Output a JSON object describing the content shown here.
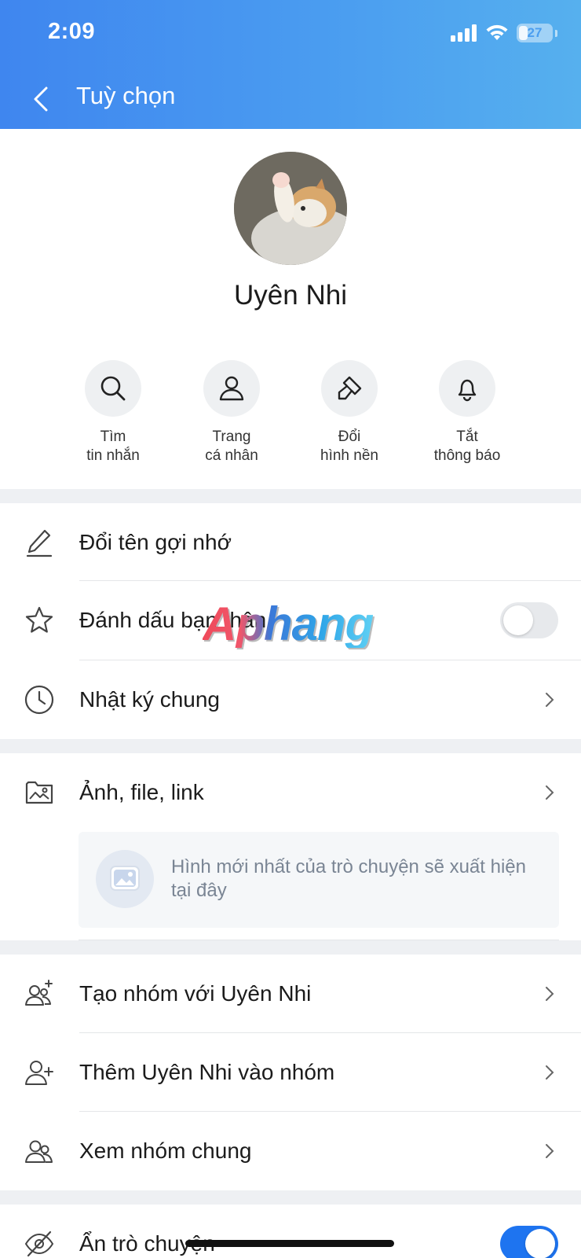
{
  "status_bar": {
    "time": "2:09",
    "battery": "27"
  },
  "header": {
    "title": "Tuỳ chọn"
  },
  "profile": {
    "name": "Uyên Nhi"
  },
  "quick_actions": [
    {
      "line1": "Tìm",
      "line2": "tin nhắn",
      "icon": "search-icon"
    },
    {
      "line1": "Trang",
      "line2": "cá nhân",
      "icon": "user-icon"
    },
    {
      "line1": "Đổi",
      "line2": "hình nền",
      "icon": "brush-icon"
    },
    {
      "line1": "Tắt",
      "line2": "thông báo",
      "icon": "bell-icon"
    }
  ],
  "settings": {
    "rename": "Đổi tên gợi nhớ",
    "close_friend": {
      "label": "Đánh dấu bạn thân",
      "on": false
    },
    "shared_diary": "Nhật ký chung",
    "media": {
      "label": "Ảnh, file, link",
      "empty_text": "Hình mới nhất của trò chuyện sẽ xuất hiện tại đây"
    },
    "create_group": "Tạo nhóm với Uyên Nhi",
    "add_to_group": "Thêm Uyên Nhi vào nhóm",
    "common_groups": "Xem nhóm chung",
    "hide_chat": {
      "label": "Ẩn trò chuyện",
      "on": true
    }
  },
  "watermark": "Aphang",
  "colors": {
    "header_start": "#3f86ef",
    "header_end": "#56b0ee",
    "toggle_on": "#1e74f0",
    "section_gap": "#eef0f3"
  }
}
